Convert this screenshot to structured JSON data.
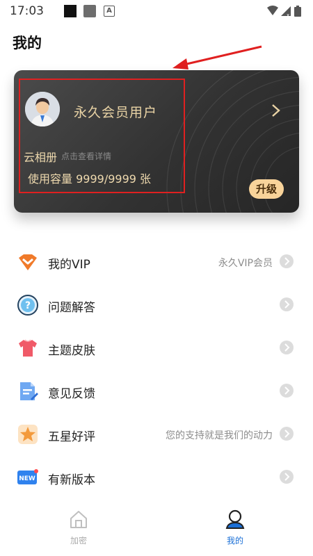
{
  "status_bar": {
    "time": "17:03",
    "indicator_letter": "A",
    "icons": [
      "wifi-icon",
      "signal-icon",
      "battery-icon"
    ]
  },
  "page": {
    "title": "我的"
  },
  "card": {
    "user_name": "永久会员用户",
    "album_label": "云相册",
    "album_hint": "点击查看详情",
    "capacity_label": "使用容量",
    "capacity_value": "9999/9999",
    "capacity_unit": "张",
    "upgrade_label": "升级",
    "accent_color": "#e9d3a5"
  },
  "menu": {
    "items": [
      {
        "label": "我的VIP",
        "value": "永久VIP会员",
        "icon": "vip-diamond-icon"
      },
      {
        "label": "问题解答",
        "value": "",
        "icon": "question-icon"
      },
      {
        "label": "主题皮肤",
        "value": "",
        "icon": "tshirt-icon"
      },
      {
        "label": "意见反馈",
        "value": "",
        "icon": "feedback-document-icon"
      },
      {
        "label": "五星好评",
        "value": "您的支持就是我们的动力",
        "icon": "star-icon"
      },
      {
        "label": "有新版本",
        "value": "",
        "icon": "new-badge-icon"
      }
    ]
  },
  "bottom_nav": {
    "tabs": [
      {
        "label": "加密",
        "icon": "home-lock-icon",
        "active": false
      },
      {
        "label": "我的",
        "icon": "profile-icon",
        "active": true
      }
    ],
    "active_color": "#1a6fd6"
  }
}
